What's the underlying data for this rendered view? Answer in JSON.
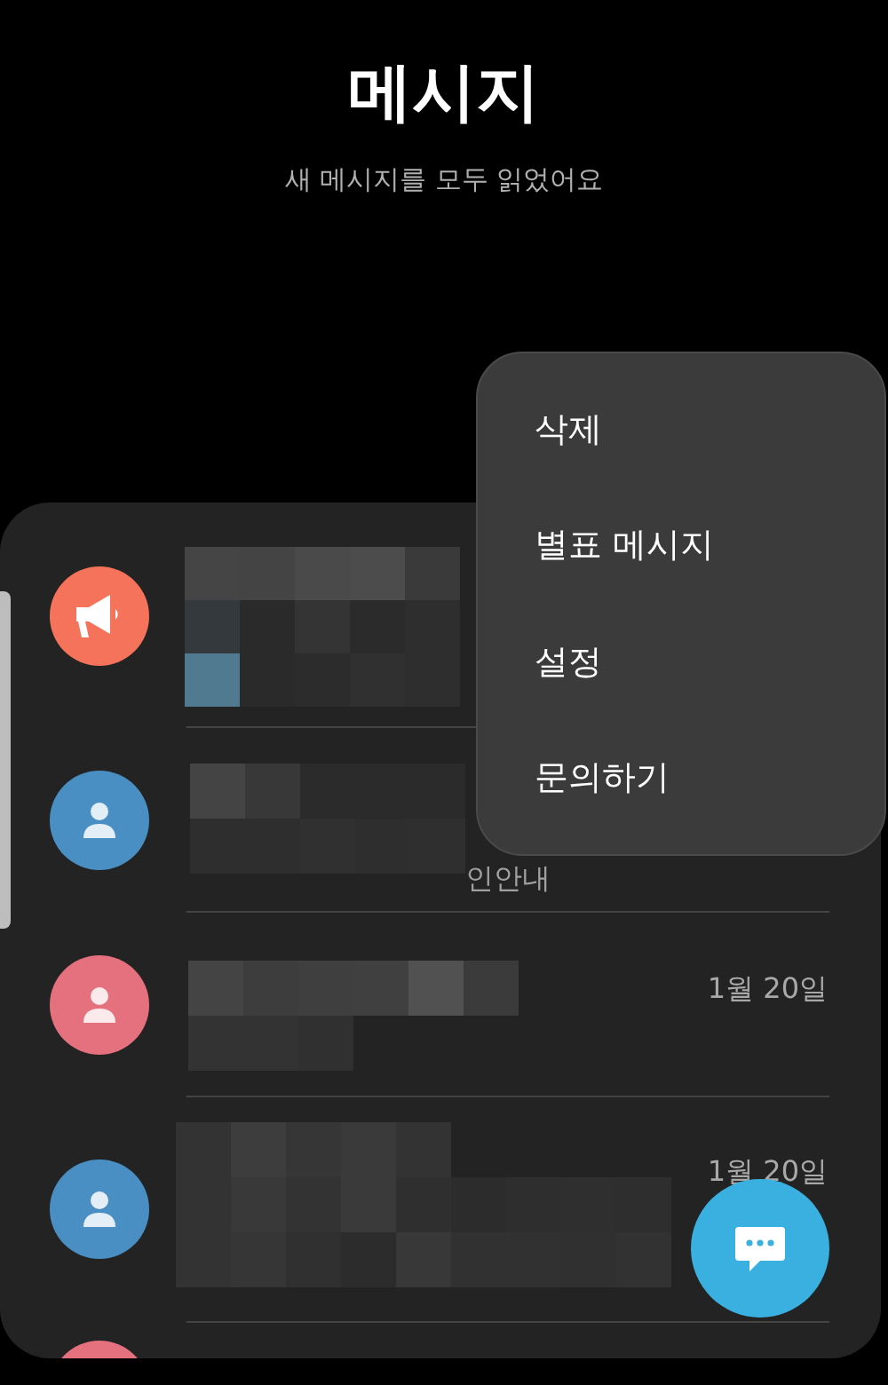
{
  "header": {
    "title": "메시지",
    "subtitle": "새 메시지를 모두 읽었어요"
  },
  "conversations": [
    {
      "kind": "megaphone",
      "color": "#f5735a"
    },
    {
      "kind": "person",
      "color": "#4a8fc4",
      "preview": "인안내"
    },
    {
      "kind": "person",
      "color": "#e5707e",
      "date": "1월 20일"
    },
    {
      "kind": "person",
      "color": "#4a8fc4",
      "date": "1월 20일"
    },
    {
      "color": "#e5707e"
    }
  ],
  "menu": [
    "삭제",
    "별표 메시지",
    "설정",
    "문의하기"
  ]
}
